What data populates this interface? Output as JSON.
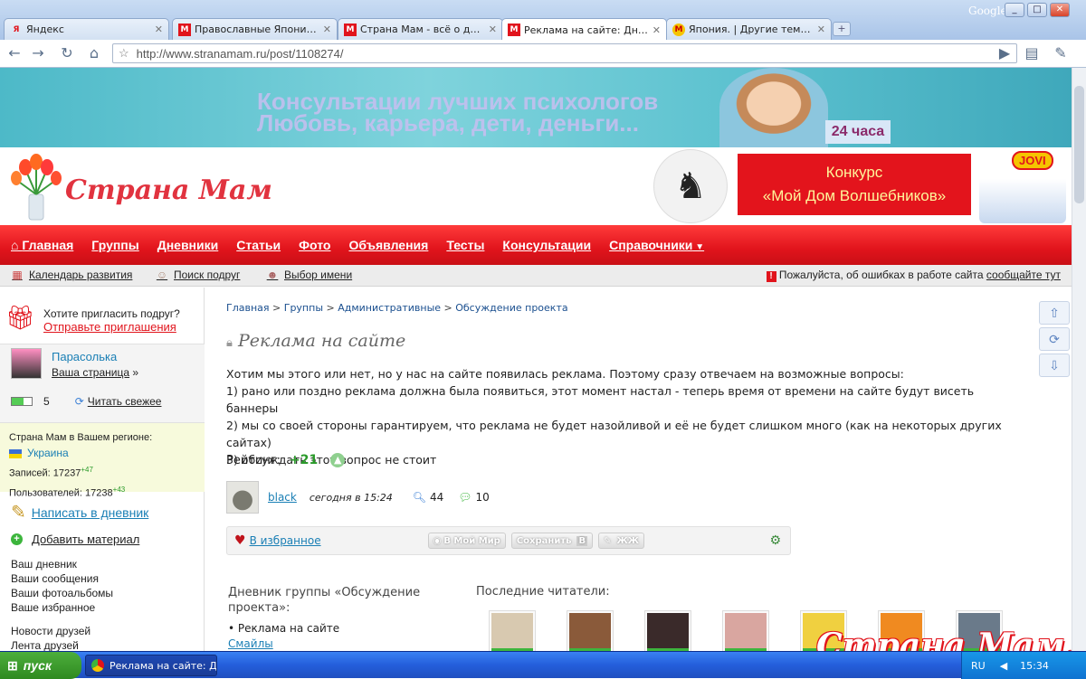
{
  "browser": {
    "tabs": [
      {
        "label": "Яндекс",
        "favicon": "Я",
        "active": false
      },
      {
        "label": "Православные Японии пр...",
        "favicon": "M",
        "active": false
      },
      {
        "label": "Страна Мам - всё о детях...",
        "favicon": "M",
        "active": false
      },
      {
        "label": "Реклама на сайте: Дневн...",
        "favicon": "M",
        "active": true
      },
      {
        "label": "Япония. | Другие темы | ...",
        "favicon": "M",
        "active": false
      }
    ],
    "new_tab_label": "+",
    "google_label": "Google",
    "url": "http://www.stranamam.ru/post/1108274/"
  },
  "banner": {
    "line1": "Консультации лучших психологов",
    "line2": "Любовь, карьера, дети, деньги...",
    "badge": "24 часа"
  },
  "site": {
    "logo_text": "Страна Мам",
    "promo_line1": "Конкурс",
    "promo_line2": "«Мой Дом Волшебников»",
    "promo_brand": "JOVI",
    "promo_caption": "Волшебников"
  },
  "nav": {
    "items": [
      "Главная",
      "Группы",
      "Дневники",
      "Статьи",
      "Фото",
      "Объявления",
      "Тесты",
      "Консультации",
      "Справочники"
    ]
  },
  "subnav": {
    "calendar": "Календарь развития",
    "friends": "Поиск подруг",
    "names": "Выбор имени",
    "notice_text": "Пожалуйста, об ошибках в работе сайта",
    "notice_link": "сообщайте тут"
  },
  "sidebar": {
    "invite_q": "Хотите пригласить подруг?",
    "invite_link": "Отправьте приглашения",
    "user_name": "Парасолька",
    "user_page": "Ваша страница",
    "battery_count": "5",
    "read_fresh": "Читать свежее",
    "region_label": "Страна Мам в Вашем регионе:",
    "region": "Украина",
    "records_label": "Записей",
    "records_value": "17237",
    "records_delta": "+47",
    "users_label": "Пользователей",
    "users_value": "17238",
    "users_delta": "+43",
    "write_diary": "Написать в дневник",
    "add_material": "Добавить материал",
    "links": [
      "Ваш дневник",
      "Ваши сообщения",
      "Ваши фотоальбомы",
      "Ваше избранное"
    ],
    "friends_news": "Новости друзей",
    "friends_feed": "Лента друзей"
  },
  "post": {
    "breadcrumb": [
      "Главная",
      "Группы",
      "Административные",
      "Обсуждение проекта"
    ],
    "title": "Реклама на сайте",
    "body": [
      "Хотим мы этого или нет, но у нас на сайте появилась реклама. Поэтому сразу отвечаем на возможные вопросы:",
      "1) рано или поздно реклама должна была появиться, этот момент настал - теперь время от времени на сайте будут висеть баннеры",
      "2) мы со своей стороны гарантируем, что реклама не будет назойливой и её не будет слишком много (как на некоторых других сайтах)",
      "3) обсуждать этот вопрос не стоит"
    ],
    "rating_label": "Рейтинг:",
    "rating_value": "+21",
    "author": "black",
    "date": "сегодня в 15:24",
    "views": "44",
    "comments": "10",
    "favorite": "В избранное",
    "share_mymir": "В Мой Мир",
    "share_save": "Сохранить",
    "share_lj": "ЖЖ"
  },
  "diary": {
    "title": "Дневник группы «Обсуждение проекта»:",
    "item": "Реклама на сайте",
    "more": "Смайлы"
  },
  "readers": {
    "title": "Последние читатели:",
    "count": 7,
    "colors": [
      "#d8c9b0",
      "#8a5a3a",
      "#3a2a2a",
      "#d9a6a0",
      "#f0d040",
      "#f08a20",
      "#6a7a8a"
    ]
  },
  "watermark": "Страна Мам.ру",
  "taskbar": {
    "start": "пуск",
    "task": "Реклама на сайте: Д...",
    "lang": "RU",
    "clock": "15:34"
  },
  "colors": {
    "brand_red": "#e1141c",
    "link": "#1a4f8f",
    "rating_green": "#2a9a2a"
  }
}
